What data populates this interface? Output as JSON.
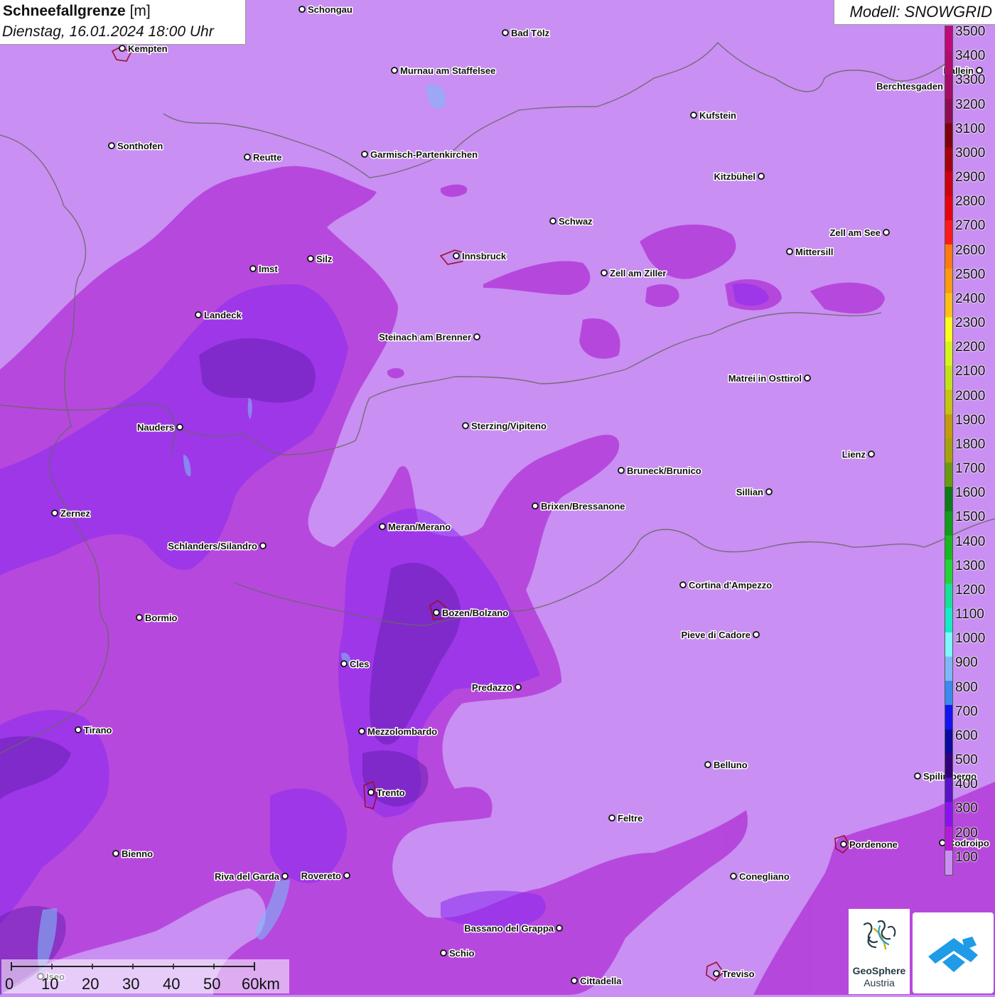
{
  "title": {
    "variable": "Schneefallgrenze",
    "unit": "[m]",
    "datetime": "Dienstag, 16.01.2024 18:00 Uhr"
  },
  "model_label": "Modell: SNOWGRID",
  "legend": {
    "levels": [
      {
        "label": "3500",
        "color": "#c2097b"
      },
      {
        "label": "3400",
        "color": "#b30a70"
      },
      {
        "label": "3300",
        "color": "#a30b66"
      },
      {
        "label": "3200",
        "color": "#8e0c55"
      },
      {
        "label": "3100",
        "color": "#7d0010"
      },
      {
        "label": "3000",
        "color": "#a50010"
      },
      {
        "label": "2900",
        "color": "#cc0012"
      },
      {
        "label": "2800",
        "color": "#e8000f"
      },
      {
        "label": "2700",
        "color": "#ff1a1a"
      },
      {
        "label": "2600",
        "color": "#ff7a10"
      },
      {
        "label": "2500",
        "color": "#ff9a12"
      },
      {
        "label": "2400",
        "color": "#ffbf18"
      },
      {
        "label": "2300",
        "color": "#ffff1e"
      },
      {
        "label": "2200",
        "color": "#d6f51e"
      },
      {
        "label": "2100",
        "color": "#c4e01c"
      },
      {
        "label": "2000",
        "color": "#c7c214"
      },
      {
        "label": "1900",
        "color": "#c49a10"
      },
      {
        "label": "1800",
        "color": "#a8a00c"
      },
      {
        "label": "1700",
        "color": "#6a9a10"
      },
      {
        "label": "1600",
        "color": "#0e7a1a"
      },
      {
        "label": "1500",
        "color": "#129c1c"
      },
      {
        "label": "1400",
        "color": "#18b822"
      },
      {
        "label": "1300",
        "color": "#22d43a"
      },
      {
        "label": "1200",
        "color": "#18e09a"
      },
      {
        "label": "1100",
        "color": "#16ecc8"
      },
      {
        "label": "1000",
        "color": "#7cf8ff"
      },
      {
        "label": "900",
        "color": "#7fb8f6"
      },
      {
        "label": "800",
        "color": "#3a8af0"
      },
      {
        "label": "700",
        "color": "#1414f0"
      },
      {
        "label": "600",
        "color": "#0a0aa0"
      },
      {
        "label": "500",
        "color": "#32007a"
      },
      {
        "label": "400",
        "color": "#5a12c8"
      },
      {
        "label": "300",
        "color": "#8a12f0"
      },
      {
        "label": "200",
        "color": "#b41ad8"
      },
      {
        "label": "100",
        "color": "#c98ff2"
      }
    ]
  },
  "cities": [
    {
      "name": "Schongau",
      "side": "right"
    },
    {
      "name": "Bad Tölz",
      "side": "right"
    },
    {
      "name": "Kempten",
      "side": "right"
    },
    {
      "name": "Murnau am Staffelsee",
      "side": "right"
    },
    {
      "name": "Hallein",
      "side": "left"
    },
    {
      "name": "Berchtesgaden",
      "side": "left"
    },
    {
      "name": "Kufstein",
      "side": "right"
    },
    {
      "name": "Sonthofen",
      "side": "right"
    },
    {
      "name": "Reutte",
      "side": "right"
    },
    {
      "name": "Garmisch-Partenkirchen",
      "side": "right"
    },
    {
      "name": "Kitzbühel",
      "side": "left"
    },
    {
      "name": "Schwaz",
      "side": "right"
    },
    {
      "name": "Zell am See",
      "side": "left"
    },
    {
      "name": "Innsbruck",
      "side": "right"
    },
    {
      "name": "Mittersill",
      "side": "right"
    },
    {
      "name": "Silz",
      "side": "right"
    },
    {
      "name": "Imst",
      "side": "right"
    },
    {
      "name": "Zell am Ziller",
      "side": "right"
    },
    {
      "name": "Landeck",
      "side": "right"
    },
    {
      "name": "Steinach am Brenner",
      "side": "left"
    },
    {
      "name": "Matrei in Osttirol",
      "side": "left"
    },
    {
      "name": "Nauders",
      "side": "left"
    },
    {
      "name": "Sterzing/Vipiteno",
      "side": "right"
    },
    {
      "name": "Lienz",
      "side": "left"
    },
    {
      "name": "Bruneck/Brunico",
      "side": "right"
    },
    {
      "name": "Sillian",
      "side": "left"
    },
    {
      "name": "Zernez",
      "side": "right"
    },
    {
      "name": "Brixen/Bressanone",
      "side": "right"
    },
    {
      "name": "Meran/Merano",
      "side": "right"
    },
    {
      "name": "Schlanders/Silandro",
      "side": "left"
    },
    {
      "name": "Cortina d'Ampezzo",
      "side": "right"
    },
    {
      "name": "Bozen/Bolzano",
      "side": "right"
    },
    {
      "name": "Bormio",
      "side": "right"
    },
    {
      "name": "Pieve di Cadore",
      "side": "left"
    },
    {
      "name": "Cles",
      "side": "right"
    },
    {
      "name": "Predazzo",
      "side": "left"
    },
    {
      "name": "Tirano",
      "side": "right"
    },
    {
      "name": "Mezzolombardo",
      "side": "right"
    },
    {
      "name": "Belluno",
      "side": "right"
    },
    {
      "name": "Spilimbergo",
      "side": "right"
    },
    {
      "name": "Trento",
      "side": "right"
    },
    {
      "name": "Feltre",
      "side": "right"
    },
    {
      "name": "Pordenone",
      "side": "right"
    },
    {
      "name": "Codroipo",
      "side": "right"
    },
    {
      "name": "Bienno",
      "side": "right"
    },
    {
      "name": "Riva del Garda",
      "side": "left"
    },
    {
      "name": "Rovereto",
      "side": "left"
    },
    {
      "name": "Conegliano",
      "side": "right"
    },
    {
      "name": "Bassano del Grappa",
      "side": "left"
    },
    {
      "name": "Schio",
      "side": "right"
    },
    {
      "name": "Treviso",
      "side": "right"
    },
    {
      "name": "Cittadella",
      "side": "right"
    },
    {
      "name": "Iseo",
      "side": "right"
    }
  ],
  "scale_bar": {
    "labels": [
      "0",
      "10",
      "20",
      "30",
      "40",
      "50",
      "60km"
    ]
  },
  "logos": {
    "geosphere_name": "GeoSphere",
    "geosphere_sub": "Austria"
  }
}
